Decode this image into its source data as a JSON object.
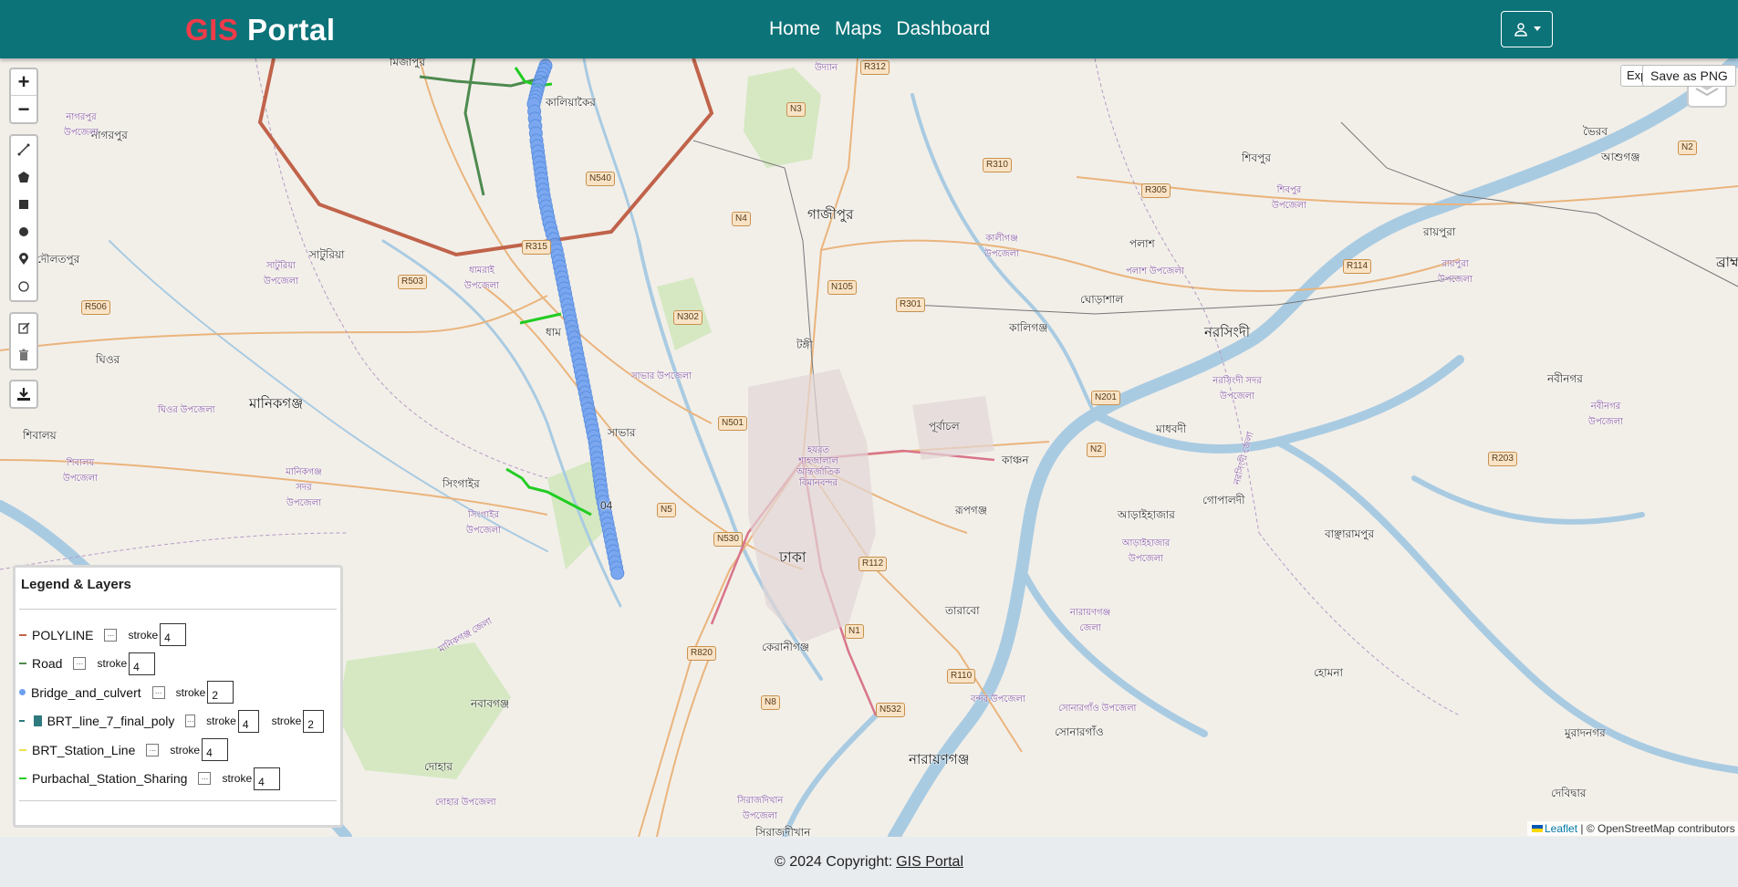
{
  "navbar": {
    "brand_part1": "GIS",
    "brand_part2": "Portal",
    "links": [
      "Home",
      "Maps",
      "Dashboard"
    ],
    "user_icon": "user-icon",
    "colors": {
      "bg": "#0c7378",
      "brand_accent": "#ef3b4a"
    }
  },
  "map_controls": {
    "zoom_in": "+",
    "zoom_out": "−",
    "draw_tools": [
      "polyline-icon",
      "polygon-icon",
      "rectangle-icon",
      "circle-icon",
      "marker-icon",
      "circlemarker-icon"
    ],
    "edit_tools": [
      "edit-icon",
      "delete-icon"
    ],
    "download_icon": "download-icon",
    "export_label": "Exp",
    "save_png_label": "Save as PNG",
    "layers_icon": "layers-icon"
  },
  "map_labels": {
    "gazipur": "গাজীপুর",
    "dhaka": "ঢাকা",
    "narsingdi": "নরসিংদী",
    "narayanganj": "নারায়ণগঞ্জ",
    "manikganj": "মানিকগঞ্জ",
    "savar": "সাভার",
    "tongi": "টঙ্গী",
    "kaliganj": "কালিগঞ্জ",
    "singair": "সিংগাইর",
    "keraniganj": "কেরানীগঞ্জ",
    "purbachal": "পূর্বাচল",
    "rupganj": "রূপগঞ্জ",
    "tarabo": "তারাবো",
    "sonargaon": "সোনারগাঁও",
    "madhabdi": "মাধবদী",
    "palash": "পলাশ",
    "shibpur": "শিবপুর",
    "raipura": "রায়পুরা",
    "ghorashal": "ঘোড়াশাল",
    "araihazar": "আড়াইহাজার",
    "gopaldi": "গোপালদী",
    "bancharampur": "বাঞ্ছারামপুর",
    "homna": "হোমনা",
    "muradnagar": "মুরাদনগর",
    "debidwar": "দেবিদ্বার",
    "ghior": "ঘিওর",
    "shibalaya": "শিবালয়",
    "daulatpur": "দৌলতপুর",
    "saturia": "সাটুরিয়া",
    "dhamrai": "ধাম",
    "kaliakair": "কালিয়াকৈর",
    "mirzapur": "মির্জাপুর",
    "nagarpur": "নাগরপুর",
    "bhairab": "ভৈরব",
    "ashuganj": "আশুগঞ্জ",
    "nabinagar": "নবীনগর",
    "nawabganj": "নবাবগঞ্জ",
    "dohar": "দোহার",
    "sirajdikhan": "সিরাজদীখান",
    "kanchan": "কাঞ্চন",
    "udyan": "উদ্যান",
    "airport": "হযরত শাহজালাল আন্তর্জাতিক বিমানবন্দর",
    "brahmanbaria": "ব্রাহ্ম",
    "savar_upazila": "সাভার উপজেলা",
    "kaliganj_upazila": "কালীগঞ্জ উপজেলা",
    "palash_upazila": "পলাশ উপজেলা",
    "raipura_upazila": "রায়পুরা উপজেলা",
    "narsingdi_sadar": "নরসিংদী সদর উপজেলা",
    "shibpur_upazila": "শিবপুর উপজেলা",
    "saturia_upazila": "সাটুরিয়া উপজেলা",
    "dhamrai_upazila": "ধামরাই উপজেলা",
    "manikganj_sadar": "মানিকগঞ্জ সদর উপজেলা",
    "ghior_upazila": "ঘিওর উপজেলা",
    "shibalaya_upazila": "শিবালয় উপজেলা",
    "singair_upazila": "সিংগাইর উপজেলা",
    "nagarpur_upazila": "নাগরপুর উপজেলা",
    "araihazar_upazila": "আড়াইহাজার উপজেলা",
    "narayanganj_district": "নারায়ণগঞ্জ জেলা",
    "bandar_upazila": "বন্দর উপজেলা",
    "sonargaon_upazila": "সোনারগাঁও উপজেলা",
    "sirajdikhan_upazila": "সিরাজদিখান উপজেলা",
    "dohar_upazila": "দোহার উপজেলা",
    "nabinagar_upazila": "নবীনগর উপজেলা",
    "manikganj_district": "মানিকগঞ্জ জেলা",
    "narsingdi_district": "নরসিংদী জেলা"
  },
  "road_shields": [
    "R312",
    "N3",
    "N540",
    "R310",
    "R305",
    "N4",
    "R315",
    "R503",
    "N105",
    "R301",
    "R114",
    "N302",
    "R506",
    "N201",
    "N501",
    "N2",
    "R203",
    "N5",
    "N530",
    "R112",
    "N1",
    "R820",
    "N8",
    "N532",
    "R110",
    "N2",
    "04"
  ],
  "legend": {
    "title": "Legend & Layers",
    "stroke_label": "stroke",
    "box_glyph": "...",
    "layers": [
      {
        "name": "POLYLINE",
        "color": "#c0634a",
        "symbol": "line",
        "strokes": [
          "4"
        ]
      },
      {
        "name": "Road",
        "color": "#4e8a4e",
        "symbol": "line",
        "strokes": [
          "4"
        ]
      },
      {
        "name": "Bridge_and_culvert",
        "color": "#6ea0f0",
        "symbol": "dot",
        "strokes": [
          "2"
        ]
      },
      {
        "name": "BRT_line_7_final_poly",
        "color": "#2e7a7e",
        "symbol": "line+square",
        "strokes": [
          "4",
          "2"
        ]
      },
      {
        "name": "BRT_Station_Line",
        "color": "#f0e04a",
        "symbol": "line",
        "strokes": [
          "4"
        ]
      },
      {
        "name": "Purbachal_Station_Sharing",
        "color": "#22cc22",
        "symbol": "line",
        "strokes": [
          "4"
        ]
      }
    ]
  },
  "attribution": {
    "leaflet": "Leaflet",
    "sep": " | © OpenStreetMap contributors"
  },
  "footer": {
    "text": "© 2024 Copyright:",
    "link": "GIS Portal"
  }
}
